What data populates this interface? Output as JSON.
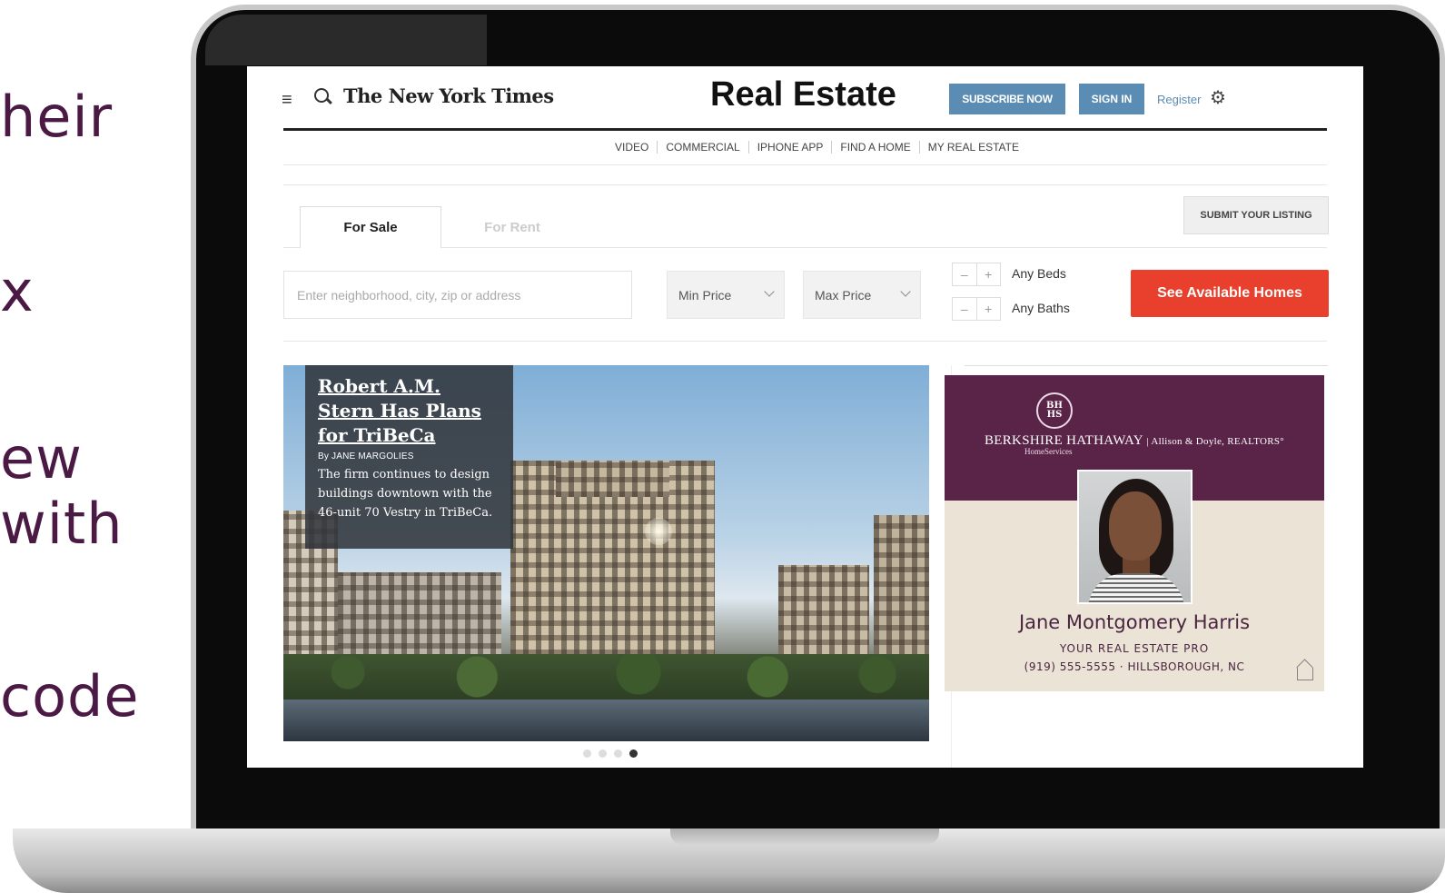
{
  "slide_fragments": [
    "heir",
    "x",
    "ew",
    "with",
    "code"
  ],
  "header": {
    "menu_glyph": "≡",
    "logo": "The New York Times",
    "section_title": "Real Estate",
    "subscribe_label": "SUBSCRIBE NOW",
    "signin_label": "SIGN IN",
    "register_label": "Register",
    "gear_glyph": "⚙"
  },
  "subnav": [
    "VIDEO",
    "COMMERCIAL",
    "IPHONE APP",
    "FIND A HOME",
    "MY REAL ESTATE"
  ],
  "tabs": {
    "for_sale": "For Sale",
    "for_rent": "For Rent"
  },
  "submit_listing_label": "SUBMIT YOUR LISTING",
  "search": {
    "placeholder": "Enter neighborhood, city, zip or address",
    "min_price": "Min Price",
    "max_price": "Max Price",
    "beds_label": "Any Beds",
    "baths_label": "Any Baths",
    "stepper_minus": "–",
    "stepper_plus": "+",
    "cta_label": "See Available Homes"
  },
  "hero": {
    "title": "Robert A.M. Stern Has Plans for TriBeCa",
    "byline": "By JANE MARGOLIES",
    "summary": "The firm continues to design buildings downtown with the 46-unit 70 Vestry in TriBeCa.",
    "carousel_dots": 4,
    "active_dot": 4
  },
  "ad": {
    "seal": "BH HS",
    "brand": "BERKSHIRE HATHAWAY",
    "affiliate": "| Allison & Doyle, REALTORS°",
    "brand_sub": "HomeServices",
    "agent_name": "Jane Montgomery Harris",
    "tagline": "YOUR REAL ESTATE PRO",
    "contact": "(919) 555-5555  ·  HILLSBOROUGH, NC",
    "colors": {
      "plum": "#5a2348",
      "cream": "#ebe3d6"
    }
  },
  "colors": {
    "accent_blue": "#5a8cb4",
    "cta_red": "#e8402c",
    "slide_text": "#4a1a45"
  }
}
